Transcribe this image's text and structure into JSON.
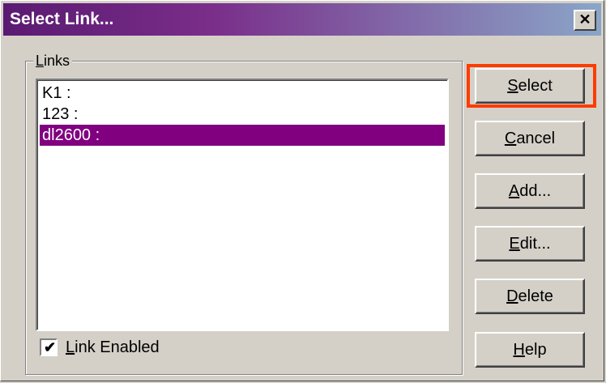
{
  "window": {
    "title": "Select Link..."
  },
  "close_glyph": "✕",
  "links_group": {
    "legend_prefix": "L",
    "legend_rest": "inks",
    "items": [
      {
        "label": "K1 :",
        "selected": false
      },
      {
        "label": "123 :",
        "selected": false
      },
      {
        "label": "dl2600 :",
        "selected": true
      }
    ]
  },
  "link_enabled": {
    "prefix": "L",
    "rest": "ink Enabled",
    "checked": true
  },
  "buttons": {
    "select": {
      "key": "S",
      "rest": "elect"
    },
    "cancel": {
      "key": "C",
      "rest": "ancel"
    },
    "add": {
      "key": "A",
      "rest": "dd..."
    },
    "edit": {
      "key": "E",
      "rest": "dit..."
    },
    "delete": {
      "key": "D",
      "rest": "elete"
    },
    "help": {
      "key": "H",
      "rest": "elp"
    }
  },
  "colors": {
    "selection": "#800080",
    "highlight_box": "#ff3b00",
    "title_gradient_start": "#5a1a72",
    "title_gradient_end": "#8aa6c8"
  }
}
